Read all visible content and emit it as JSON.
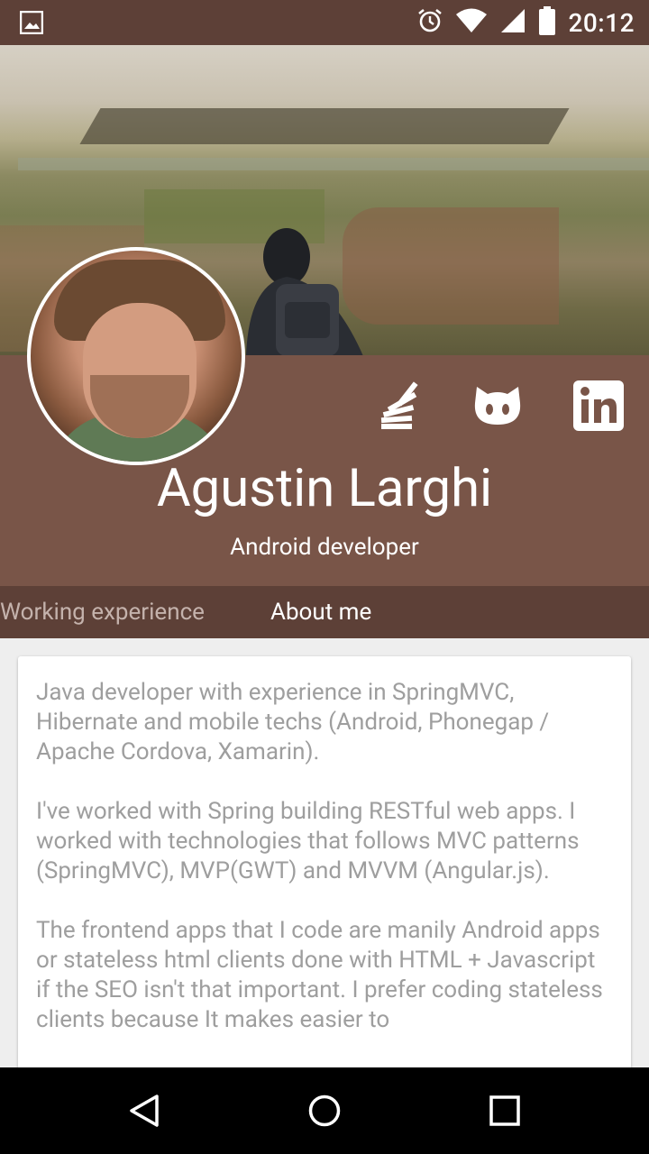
{
  "status_bar": {
    "time": "20:12",
    "icons": [
      "gallery-icon",
      "alarm-icon",
      "wifi-icon",
      "signal-icon",
      "battery-icon"
    ]
  },
  "profile": {
    "name": "Agustin Larghi",
    "role": "Android developer",
    "social": [
      "stackoverflow-icon",
      "github-icon",
      "linkedin-icon"
    ]
  },
  "tabs": [
    {
      "label": "Working experience",
      "selected": false
    },
    {
      "label": "About me",
      "selected": true
    }
  ],
  "about": {
    "paragraphs": [
      "Java developer with experience in SpringMVC, Hibernate and mobile techs (Android, Phonegap / Apache Cordova, Xamarin).",
      "I've worked with Spring building RESTful web apps. I worked with technologies that follows MVC patterns (SpringMVC), MVP(GWT) and MVVM (Angular.js).",
      "The frontend apps that I code are manily Android apps or stateless html clients done with HTML + Javascript if the SEO isn't that important. I prefer coding stateless clients because It makes easier to"
    ]
  },
  "navigation": [
    "back-icon",
    "home-icon",
    "recents-icon"
  ],
  "colors": {
    "status_bar": "#5d4037",
    "panel": "#795548",
    "tabs": "#5d4037",
    "content_bg": "#eeeeee",
    "body_text": "#9e9e9e"
  }
}
